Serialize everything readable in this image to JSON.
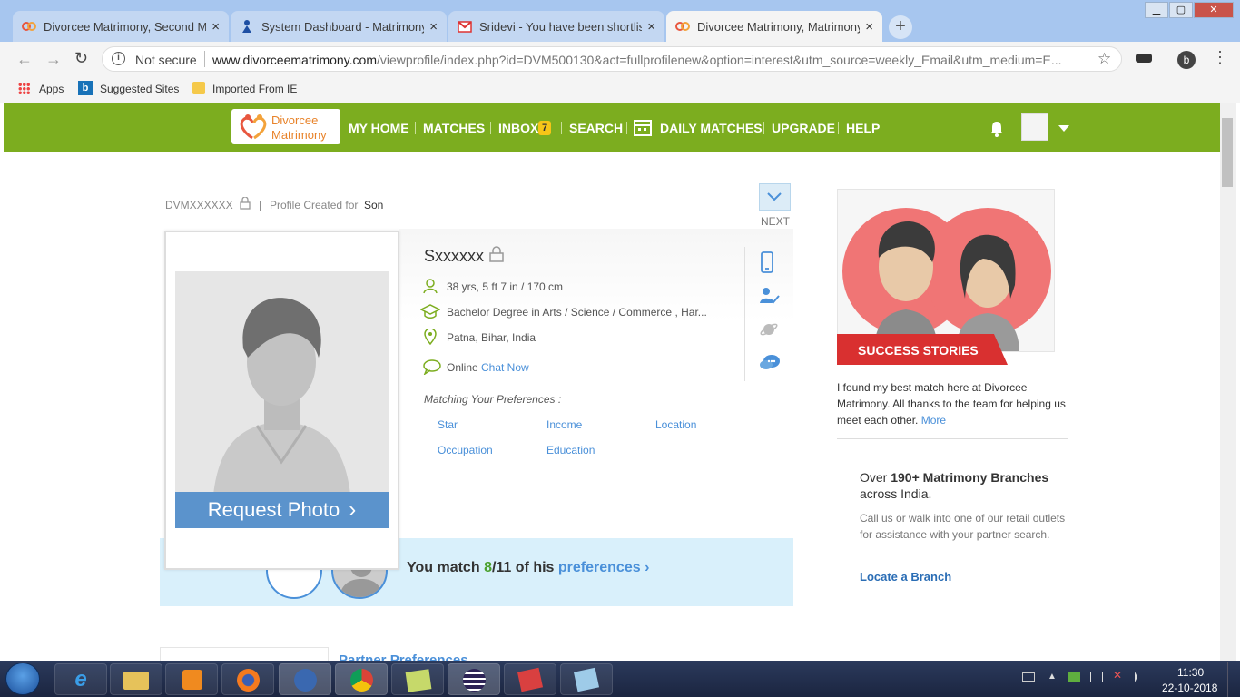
{
  "browser": {
    "tabs": [
      {
        "title": "Divorcee Matrimony, Second Ma"
      },
      {
        "title": "System Dashboard - Matrimony.c"
      },
      {
        "title": "Sridevi - You have been shortliste"
      },
      {
        "title": "Divorcee Matrimony, Matrimony"
      }
    ],
    "security": "Not secure",
    "url_domain": "www.divorceematrimony.com",
    "url_path": "/viewprofile/index.php?id=DVM500130&act=fullprofilenew&option=interest&utm_source=weekly_Email&utm_medium=E...",
    "profile_letter": "b",
    "bookmarks": [
      "Apps",
      "Suggested Sites",
      "Imported From IE"
    ]
  },
  "site": {
    "logo_line1": "Divorcee",
    "logo_line2": "Matrimony",
    "nav": [
      "MY HOME",
      "MATCHES",
      "INBOX",
      "SEARCH",
      "DAILY MATCHES",
      "UPGRADE",
      "HELP"
    ],
    "inbox_count": "7",
    "colors": {
      "nav_green": "#7cad1f",
      "link_blue": "#4a90d9",
      "request_blue": "#5b93cc"
    }
  },
  "profile": {
    "id": "DVMXXXXXX",
    "created_label": "Profile Created for",
    "created_for": "Son",
    "next_label": "NEXT",
    "name": "Sxxxxxx",
    "age_height": "38 yrs, 5 ft 7 in / 170 cm",
    "education": "Bachelor Degree in Arts / Science / Commerce , Har...",
    "location": "Patna, Bihar, India",
    "online_label": "Online",
    "chat_label": "Chat Now",
    "pref_heading": "Matching Your Preferences :",
    "prefs": [
      "Star",
      "Income",
      "Location",
      "Occupation",
      "Education"
    ],
    "request_photo": "Request Photo",
    "match_text_1": "You match",
    "match_num": "8",
    "match_total": "/11",
    "match_text_2": "of his",
    "match_link": "preferences",
    "bottom_heading": "Partner Preferences"
  },
  "sidebar": {
    "success_label": "SUCCESS STORIES",
    "testimonial": "I found my best match here at Divorcee Matrimony. All thanks to the team for helping us meet each other.",
    "more": "More",
    "branches_prefix": "Over",
    "branches_bold": "190+ Matrimony Branches",
    "branches_suffix": "across India.",
    "branches_desc": "Call us or walk into one of our retail outlets for assistance with your partner search.",
    "locate": "Locate a Branch"
  },
  "taskbar": {
    "time": "11:30",
    "date": "22-10-2018"
  }
}
